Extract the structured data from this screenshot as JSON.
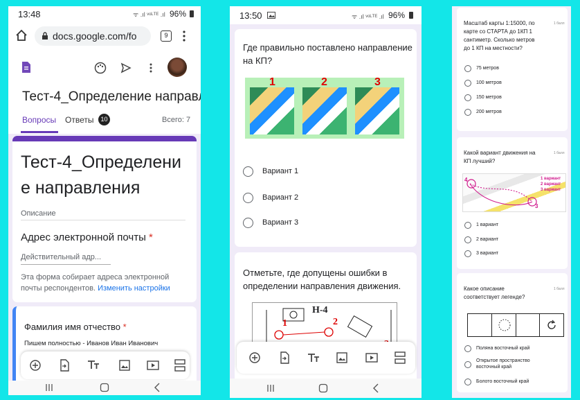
{
  "phone1": {
    "status": {
      "time": "13:48",
      "signal": "ᯤ .ıl ᵛᵒᴸᵀᴱ .ıl",
      "battery": "96%"
    },
    "browser": {
      "url": "docs.google.com/fo",
      "tab_count": "9"
    },
    "form_title_short": "Тест-4_Определение направл",
    "tabs": {
      "questions": "Вопросы",
      "responses": "Ответы",
      "responses_count": "10",
      "total": "Всего: 7"
    },
    "form_title_line1": "Тест-4_Определени",
    "form_title_line2": "е направления",
    "description": "Описание",
    "email_label": "Адрес электронной почты",
    "required_mark": "*",
    "email_placeholder": "Действительный адр...",
    "collect_note_line1": "Эта форма собирает адреса электронной",
    "collect_note_line2": "почты респондентов.",
    "change_settings": "Изменить настройки",
    "question_label": "Фамилия имя отчество",
    "question_hint": "Пишем полностью - Иванов Иван Иванович"
  },
  "phone2": {
    "status": {
      "time": "13:50",
      "signal": "ᯤ .ıl ᵛᵒᴸᵀᴱ .ıl",
      "battery": "96%"
    },
    "q1_line1": "Где правильно поставлено направление",
    "q1_line2": "на КП?",
    "image_numbers": [
      "1",
      "2",
      "3"
    ],
    "options": [
      "Вариант 1",
      "Вариант 2",
      "Вариант 3"
    ],
    "q2_line1": "Отметьте, где допущены ошибки в",
    "q2_line2": "определении направления движения.",
    "diagram_label": "Н-4",
    "diagram_numbers": [
      "1",
      "2",
      "3"
    ]
  },
  "phone3": {
    "q1": {
      "lines": [
        "Масштаб карты 1:15000, по",
        "карте со СТАРТА до 1КП 1",
        "сантиметр. Сколько метров",
        "до 1 КП на местности?"
      ],
      "points": "1 балл",
      "options": [
        "75 метров",
        "100 метров",
        "150 метров",
        "200 метров"
      ]
    },
    "q2": {
      "lines": [
        "Какой вариант движения на",
        "КП лучший?"
      ],
      "points": "1 балл",
      "legend": [
        "1 вариант",
        "2 вариант",
        "3 вариант"
      ],
      "map_numbers": [
        "4",
        "3"
      ],
      "options": [
        "1 вариант",
        "2 вариант",
        "3 вариант"
      ]
    },
    "q3": {
      "lines": [
        "Какое описание",
        "соответствует легенде?"
      ],
      "points": "1 балл",
      "options": [
        "Поляна восточный край",
        "Открытое пространство",
        "восточный край",
        "Болото восточный край"
      ]
    }
  },
  "colors": {
    "accent": "#673ab7",
    "cyan": "#13e6e8",
    "link": "#1a73e8",
    "required": "#d93025"
  }
}
